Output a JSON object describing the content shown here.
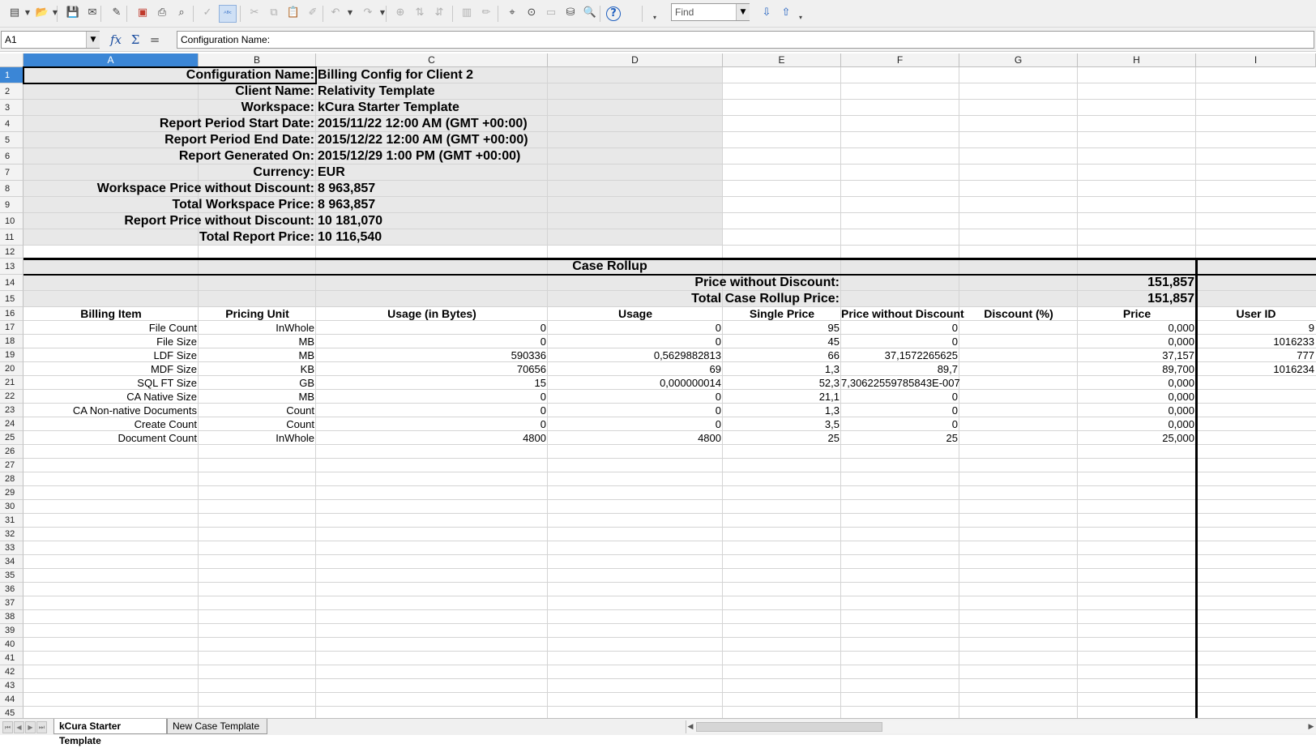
{
  "toolbar": {
    "icons": [
      "new-document-icon",
      "open-folder-icon",
      "save-icon",
      "email-icon",
      "edit-file-icon",
      "export-pdf-icon",
      "print-icon",
      "print-preview-icon",
      "spellcheck-icon",
      "autospellcheck-icon",
      "cut-icon",
      "copy-icon",
      "paste-icon",
      "format-paintbrush-icon",
      "undo-icon",
      "redo-icon",
      "hyperlink-icon",
      "sort-ascending-icon",
      "sort-descending-icon",
      "chart-icon",
      "draw-functions-icon",
      "find-replace-icon",
      "navigator-icon",
      "gallery-icon",
      "data-sources-icon",
      "zoom-icon",
      "help-icon"
    ],
    "find_placeholder": "Find"
  },
  "formula": {
    "cell_ref": "A1",
    "content": "Configuration Name:",
    "fx_symbol": "fx",
    "sum_symbol": "Σ",
    "equals_symbol": "="
  },
  "columns": [
    "A",
    "B",
    "C",
    "D",
    "E",
    "F",
    "G",
    "H",
    "I"
  ],
  "rows": [
    "1",
    "2",
    "3",
    "4",
    "5",
    "6",
    "7",
    "8",
    "9",
    "10",
    "11",
    "12",
    "13",
    "14",
    "15",
    "16",
    "17",
    "18",
    "19",
    "20",
    "21",
    "22",
    "23",
    "24",
    "25",
    "26",
    "27",
    "28",
    "29",
    "30",
    "31",
    "32",
    "33",
    "34",
    "35",
    "36",
    "37",
    "38",
    "39",
    "40",
    "41",
    "42",
    "43",
    "44",
    "45"
  ],
  "config": {
    "labels": [
      "Configuration Name:",
      "Client Name:",
      "Workspace:",
      "Report Period Start Date:",
      "Report Period End Date:",
      "Report Generated On:",
      "Currency:",
      "Workspace Price without Discount:",
      "Total Workspace Price:",
      "Report Price without Discount:",
      "Total Report Price:"
    ],
    "values": [
      "Billing Config for Client 2",
      "Relativity Template",
      "kCura Starter Template",
      "2015/11/22 12:00 AM (GMT +00:00)",
      "2015/12/22 12:00 AM (GMT +00:00)",
      "2015/12/29 1:00 PM (GMT +00:00)",
      "EUR",
      "8 963,857",
      "8 963,857",
      "10 181,070",
      "10 116,540"
    ]
  },
  "rollup": {
    "title": "Case Rollup",
    "price_without_discount_label": "Price without Discount:",
    "price_without_discount_value": "151,857",
    "total_label": "Total Case Rollup Price:",
    "total_value": "151,857"
  },
  "table": {
    "headers": [
      "Billing Item",
      "Pricing Unit",
      "Usage (in Bytes)",
      "Usage",
      "Single Price",
      "Price without Discount",
      "Discount (%)",
      "Price",
      "User ID"
    ],
    "rows": [
      [
        "File Count",
        "InWhole",
        "0",
        "0",
        "95",
        "0",
        "",
        "0,000",
        "9"
      ],
      [
        "File Size",
        "MB",
        "0",
        "0",
        "45",
        "0",
        "",
        "0,000",
        "1016233"
      ],
      [
        "LDF Size",
        "MB",
        "590336",
        "0,5629882813",
        "66",
        "37,1572265625",
        "",
        "37,157",
        "777"
      ],
      [
        "MDF Size",
        "KB",
        "70656",
        "69",
        "1,3",
        "89,7",
        "",
        "89,700",
        "1016234"
      ],
      [
        "SQL FT Size",
        "GB",
        "15",
        "0,000000014",
        "52,3",
        "7,30622559785843E-007",
        "",
        "0,000",
        ""
      ],
      [
        "CA Native Size",
        "MB",
        "0",
        "0",
        "21,1",
        "0",
        "",
        "0,000",
        ""
      ],
      [
        "CA Non-native Documents",
        "Count",
        "0",
        "0",
        "1,3",
        "0",
        "",
        "0,000",
        ""
      ],
      [
        "Create Count",
        "Count",
        "0",
        "0",
        "3,5",
        "0",
        "",
        "0,000",
        ""
      ],
      [
        "Document Count",
        "InWhole",
        "4800",
        "4800",
        "25",
        "25",
        "",
        "25,000",
        ""
      ]
    ]
  },
  "sheets": [
    "kCura Starter Template",
    "New Case Template"
  ]
}
